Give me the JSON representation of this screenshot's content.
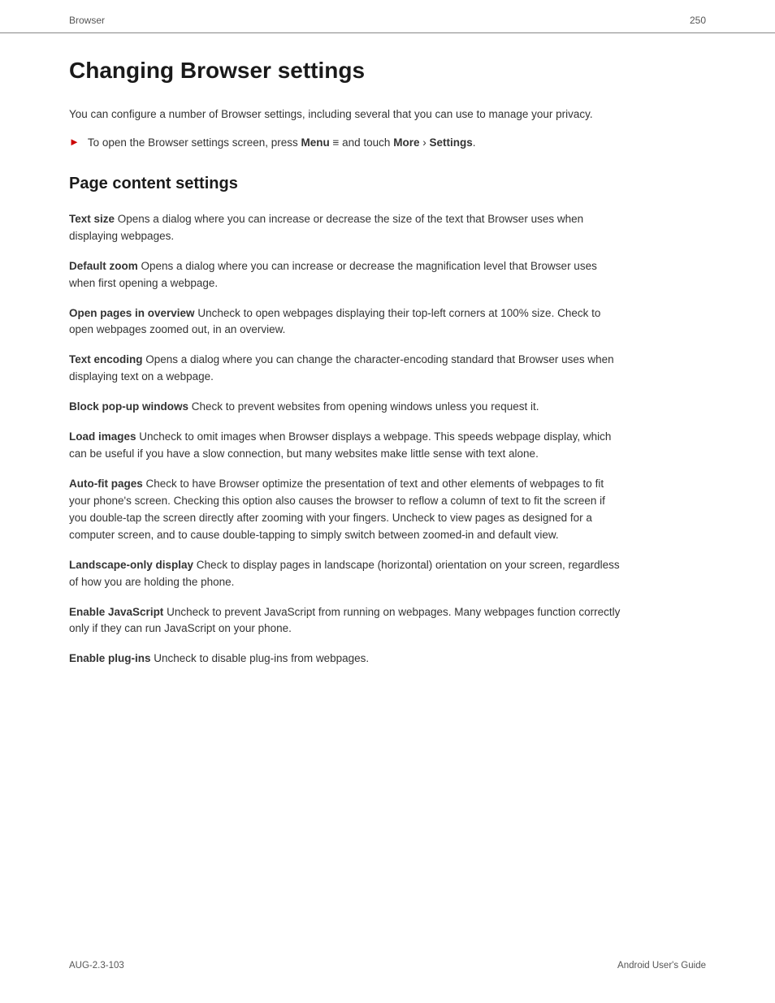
{
  "header": {
    "left": "Browser",
    "right": "250"
  },
  "page_title": "Changing Browser settings",
  "intro": {
    "text": "You can configure a number of Browser settings, including several that you can use to manage your privacy.",
    "bullet_text_part1": "To open the Browser settings screen, press ",
    "bullet_bold1": "Menu",
    "bullet_menu_symbol": " ≡",
    "bullet_text_part2": " and touch ",
    "bullet_bold2": "More",
    "bullet_text_part3": " › ",
    "bullet_bold3": "Settings",
    "bullet_text_part4": "."
  },
  "section_heading": "Page content settings",
  "settings": [
    {
      "term": "Text size",
      "description": "  Opens a dialog where you can increase or decrease the size of the text that Browser uses when displaying webpages."
    },
    {
      "term": "Default zoom",
      "description": "  Opens a dialog where you can increase or decrease the magnification level that Browser uses when first opening a webpage."
    },
    {
      "term": "Open pages in overview",
      "description": "  Uncheck to open webpages displaying their top-left corners at 100% size. Check to open webpages zoomed out, in an overview."
    },
    {
      "term": "Text encoding",
      "description": "  Opens a dialog where you can change the character-encoding standard that Browser uses when displaying text on a webpage."
    },
    {
      "term": "Block pop-up windows",
      "description": "  Check to prevent websites from opening windows unless you request it."
    },
    {
      "term": "Load images",
      "description": "  Uncheck to omit images when Browser displays a webpage. This speeds webpage display, which can be useful if you have a slow connection, but many websites make little sense with text alone."
    },
    {
      "term": "Auto-fit pages",
      "description": "  Check to have Browser optimize the presentation of text and other elements of webpages to fit your phone's screen. Checking this option also causes the browser to reflow a column of text to fit the screen if you double-tap the screen directly after zooming with your fingers. Uncheck to view pages as designed for a computer screen, and to cause double-tapping to simply switch between zoomed-in and default view."
    },
    {
      "term": "Landscape-only display",
      "description": "  Check to display pages in landscape (horizontal) orientation on your screen, regardless of how you are holding the phone."
    },
    {
      "term": "Enable JavaScript",
      "description": "  Uncheck to prevent JavaScript from running on webpages. Many webpages function correctly only if they can run JavaScript on your phone."
    },
    {
      "term": "Enable plug-ins",
      "description": "  Uncheck to disable plug-ins from webpages."
    }
  ],
  "footer": {
    "left": "AUG-2.3-103",
    "right": "Android User's Guide"
  }
}
